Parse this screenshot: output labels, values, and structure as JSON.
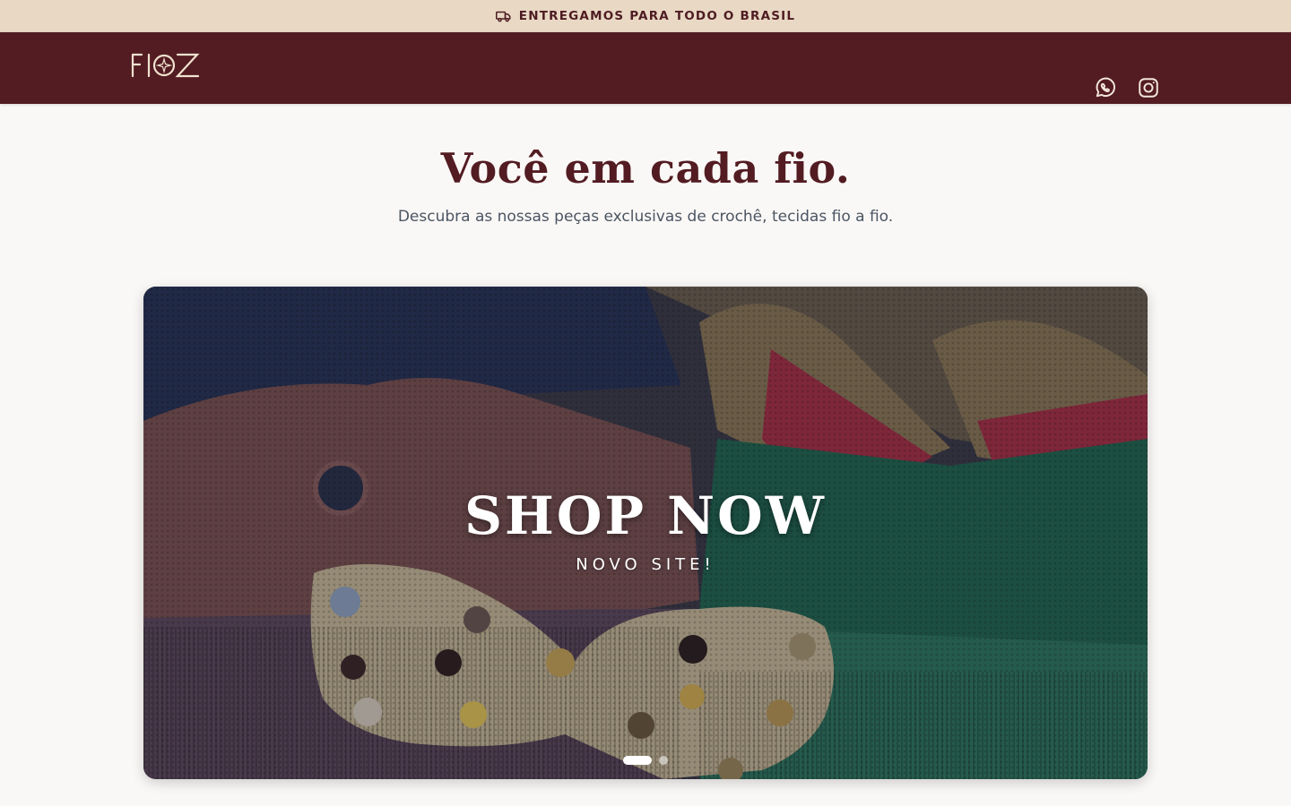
{
  "announcement": {
    "text": "ENTREGAMOS PARA TODO O BRASIL",
    "icon": "truck-icon"
  },
  "header": {
    "logo_text": "FIOZ",
    "icons": [
      "whatsapp-icon",
      "instagram-icon"
    ]
  },
  "hero": {
    "title": "Você em cada fio.",
    "subtitle": "Descubra as nossas peças exclusivas de crochê, tecidas fio a fio."
  },
  "banner": {
    "headline": "SHOP NOW",
    "subheadline": "NOVO SITE!",
    "slides_count": 2,
    "active_slide": 1
  },
  "colors": {
    "brand": "#521c22",
    "announcement_bg": "#e8d8c4",
    "page_bg": "#faf8f6"
  }
}
